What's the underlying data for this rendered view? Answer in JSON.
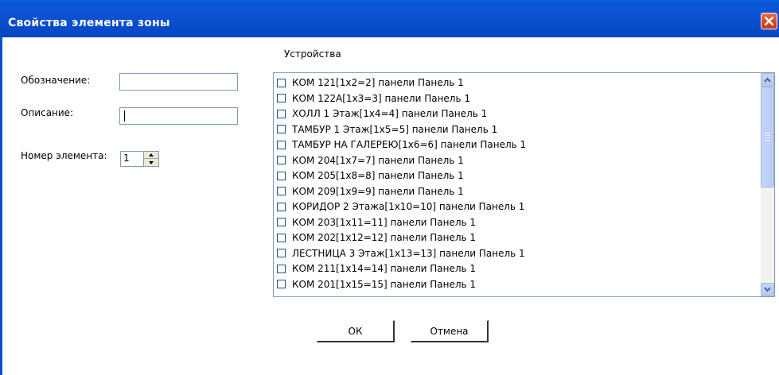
{
  "window": {
    "title": "Свойства элемента зоны"
  },
  "form": {
    "designation_label": "Обозначение:",
    "designation_value": "",
    "description_label": "Описание:",
    "description_value": "",
    "element_number_label": "Номер элемента:",
    "element_number_value": "1"
  },
  "devices": {
    "header": "Устройства",
    "items": [
      {
        "label": "КОМ 121[1x2=2] панели Панель 1",
        "checked": false
      },
      {
        "label": "КОМ 122А[1x3=3] панели Панель 1",
        "checked": false
      },
      {
        "label": "ХОЛЛ 1 Этаж[1x4=4] панели Панель 1",
        "checked": false
      },
      {
        "label": "ТАМБУР 1 Этаж[1x5=5] панели Панель 1",
        "checked": false
      },
      {
        "label": "ТАМБУР НА ГАЛЕРЕЮ[1x6=6] панели Панель 1",
        "checked": false
      },
      {
        "label": "КОМ 204[1x7=7] панели Панель 1",
        "checked": false
      },
      {
        "label": "КОМ 205[1x8=8] панели Панель 1",
        "checked": false
      },
      {
        "label": "КОМ 209[1x9=9] панели Панель 1",
        "checked": false
      },
      {
        "label": "КОРИДОР 2 Этажа[1x10=10] панели Панель 1",
        "checked": false
      },
      {
        "label": "КОМ 203[1x11=11] панели Панель 1",
        "checked": false
      },
      {
        "label": "КОМ 202[1x12=12] панели Панель 1",
        "checked": false
      },
      {
        "label": "ЛЕСТНИЦА 3 Этаж[1x13=13] панели Панель 1",
        "checked": false
      },
      {
        "label": "КОМ 211[1x14=14] панели Панель 1",
        "checked": false
      },
      {
        "label": "КОМ 201[1x15=15] панели Панель 1",
        "checked": false
      }
    ]
  },
  "buttons": {
    "ok": "ОК",
    "cancel": "Отмена"
  },
  "colors": {
    "titlebar": "#0a4fd0",
    "close": "#d9451e",
    "border": "#7f9db9"
  },
  "icons": {
    "close": "close-icon",
    "scroll_up": "chevron-up-icon",
    "scroll_down": "chevron-down-icon"
  }
}
